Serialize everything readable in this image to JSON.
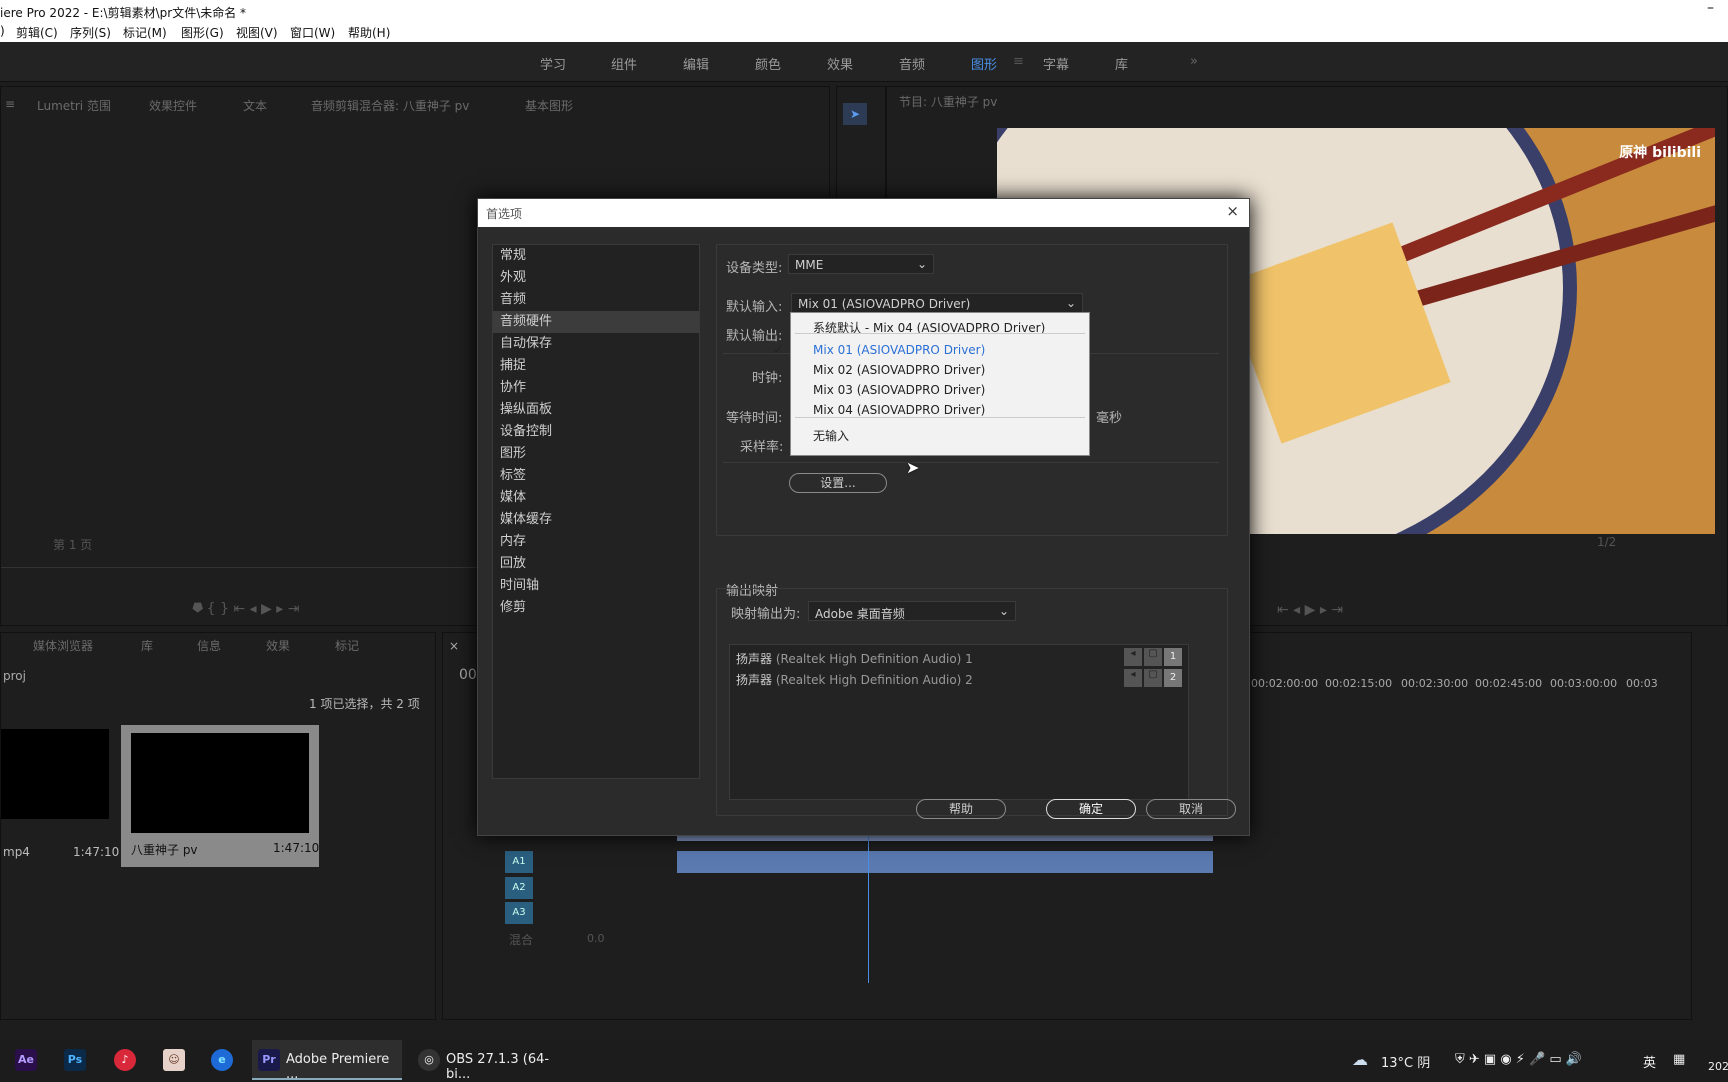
{
  "titlebar": {
    "title": "iere Pro 2022 - E:\\剪辑素材\\pr文件\\未命名 *",
    "minimize": "–"
  },
  "menu": [
    "剪辑(C)",
    "序列(S)",
    "标记(M)",
    "图形(G)",
    "视图(V)",
    "窗口(W)",
    "帮助(H)"
  ],
  "workspaces": [
    "学习",
    "组件",
    "编辑",
    "颜色",
    "效果",
    "音频",
    "图形",
    "字幕",
    "库"
  ],
  "active_workspace": "图形",
  "source_panel": {
    "tabs": [
      "Lumetri 范围",
      "效果控件",
      "文本",
      "音频剪辑混合器: 八重神子 pv",
      "基本图形"
    ],
    "page": "第 1 页"
  },
  "program_panel": {
    "title": "节目: 八重神子 pv",
    "watermark": "原神 bilibili",
    "fraction": "1/2"
  },
  "project_panel": {
    "tabs": [
      "媒体浏览器",
      "库",
      "信息",
      "效果",
      "标记"
    ],
    "project": "proj",
    "selection": "1 项已选择，共 2 项",
    "items": [
      {
        "name": "mp4",
        "duration": "1:47:10"
      },
      {
        "name": "八重神子 pv",
        "duration": "1:47:10"
      }
    ]
  },
  "timeline": {
    "timecodes": [
      "00:02:00:00",
      "00:02:15:00",
      "00:02:30:00",
      "00:02:45:00",
      "00:03:00:00",
      "00:03"
    ],
    "tracks": [
      "A1",
      "A2",
      "A3"
    ],
    "mix_label": "混合",
    "mix_value": "0.0",
    "tc_prefix": "00"
  },
  "dialog": {
    "title": "首选项",
    "categories": [
      "常规",
      "外观",
      "音频",
      "音频硬件",
      "自动保存",
      "捕捉",
      "协作",
      "操纵面板",
      "设备控制",
      "图形",
      "标签",
      "媒体",
      "媒体缓存",
      "内存",
      "回放",
      "时间轴",
      "修剪"
    ],
    "selected_category": "音频硬件",
    "device_type_label": "设备类型:",
    "device_type": "MME",
    "default_input_label": "默认输入:",
    "default_input": "Mix 01 (ASIOVADPRO Driver)",
    "default_output_label": "默认输出:",
    "clock_label": "时钟:",
    "latency_label": "等待时间:",
    "latency_unit": "毫秒",
    "sample_rate_label": "采样率:",
    "settings_button": "设置...",
    "output_mapping_title": "输出映射",
    "map_output_label": "映射输出为:",
    "map_output": "Adobe 桌面音频",
    "speakers": [
      {
        "name": "扬声器",
        "device": "(Realtek High Definition Audio) 1",
        "ch": "1"
      },
      {
        "name": "扬声器",
        "device": "(Realtek High Definition Audio) 2",
        "ch": "2"
      }
    ],
    "help": "帮助",
    "ok": "确定",
    "cancel": "取消"
  },
  "dropdown": {
    "items": [
      "系统默认 - Mix 04 (ASIOVADPRO Driver)",
      "Mix 01 (ASIOVADPRO Driver)",
      "Mix 02 (ASIOVADPRO Driver)",
      "Mix 03 (ASIOVADPRO Driver)",
      "Mix 04 (ASIOVADPRO Driver)",
      "无输入"
    ],
    "checked": "Mix 01 (ASIOVADPRO Driver)",
    "check": "✓"
  },
  "taskbar": {
    "apps": [
      {
        "icon": "Ae",
        "color": "#2a0f4a",
        "fg": "#b59cff"
      },
      {
        "icon": "Ps",
        "color": "#0b2a4a",
        "fg": "#4fb3ff"
      }
    ],
    "premiere_label": "Adobe Premiere ...",
    "obs_label": "OBS 27.1.3 (64-bi...",
    "weather": "13°C 阴",
    "ime": "英",
    "year": "202"
  }
}
